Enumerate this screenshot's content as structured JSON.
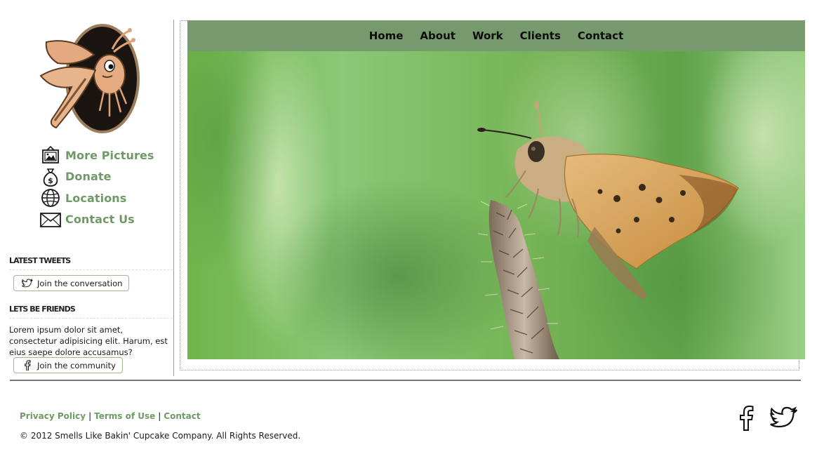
{
  "nav": {
    "items": [
      {
        "label": "Home"
      },
      {
        "label": "About"
      },
      {
        "label": "Work"
      },
      {
        "label": "Clients"
      },
      {
        "label": "Contact"
      }
    ]
  },
  "sidebar": {
    "links": [
      {
        "label": "More Pictures",
        "icon": "picture-icon"
      },
      {
        "label": "Donate",
        "icon": "money-bag-icon"
      },
      {
        "label": "Locations",
        "icon": "globe-icon"
      },
      {
        "label": "Contact Us",
        "icon": "envelope-icon"
      }
    ],
    "tweets": {
      "heading": "LATEST TWEETS",
      "button_label": "Join the conversation",
      "button_icon": "twitter-bird-icon"
    },
    "friends": {
      "heading": "LETS BE FRIENDS",
      "text": "Lorem ipsum dolor sit amet, consectetur adipisicing elit. Harum, est eius saepe dolore accusamus?",
      "button_label": "Join the community",
      "button_icon": "facebook-icon"
    }
  },
  "footer": {
    "links": [
      {
        "label": "Privacy Policy"
      },
      {
        "label": "Terms of Use"
      },
      {
        "label": "Contact"
      }
    ],
    "separator": "|",
    "copyright": "© 2012 Smells Like Bakin' Cupcake Company. All Rights Reserved.",
    "social": [
      "facebook-icon",
      "twitter-bird-icon"
    ]
  },
  "colors": {
    "accent_green": "#6f9a66",
    "navbar_bg": "#769a6d",
    "text_dark": "#1a1a1a"
  }
}
